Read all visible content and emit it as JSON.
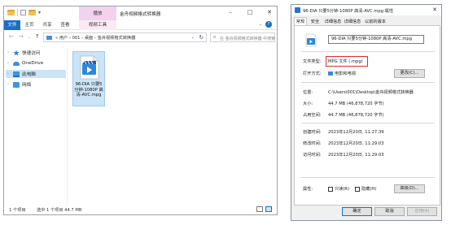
{
  "explorer": {
    "window_title": "金舟视频格式转换器",
    "context_tab_label": "播放",
    "ribbon_tabs": [
      "文件",
      "主页",
      "共享",
      "查看",
      "视频工具"
    ],
    "address_path": "«  用户  ›  001  ›  桌面  ›  金舟视频格式转换器",
    "search_placeholder": "在 金舟视频格式转换器 中搜索",
    "nav_items": [
      "快速访问",
      "OneDrive",
      "此电脑",
      "网络"
    ],
    "file": {
      "name": "96-DIA 只要5分钟-1080P 高清-AVC.mpg"
    },
    "status": {
      "count": "1 个项目",
      "selection": "选中 1 个项目 44.7 MB"
    }
  },
  "properties": {
    "title": "96-DIA 只要5分钟-1080P 高清-AVC.mpg 属性",
    "tabs": [
      "常规",
      "安全",
      "详细信息",
      "详细信息",
      "以前的版本"
    ],
    "file_name": "96-DIA 只要5分钟-1080P 高清-AVC.mpg",
    "rows": {
      "type_label": "文件类型:",
      "type_value": "MPG 文件 (.mpg)",
      "opens_label": "打开方式:",
      "opens_value": "电影和电视",
      "change_button": "更改(C)...",
      "location_label": "位置:",
      "location_value": "C:\\Users\\001\\Desktop\\金舟视频格式转换器",
      "size_label": "大小:",
      "size_value": "44.7 MB (46,878,720 字节)",
      "disk_label": "占用空间:",
      "disk_value": "44.7 MB (46,878,720 字节)",
      "created_label": "创建时间:",
      "created_value": "2023年12月20日, 11:27:39",
      "modified_label": "修改时间:",
      "modified_value": "2023年12月20日, 11:29:03",
      "accessed_label": "访问时间:",
      "accessed_value": "2023年12月20日, 11:29:03",
      "attributes_label": "属性:",
      "readonly_label": "只读(R)",
      "hidden_label": "隐藏(H)",
      "advanced_button": "高级(D)..."
    },
    "buttons": {
      "ok": "确定",
      "cancel": "取消",
      "apply": "应用(A)"
    }
  },
  "colors": {
    "accent": "#1a6fc8",
    "selection": "#cce4f7",
    "highlight_box": "#e02b2b"
  }
}
